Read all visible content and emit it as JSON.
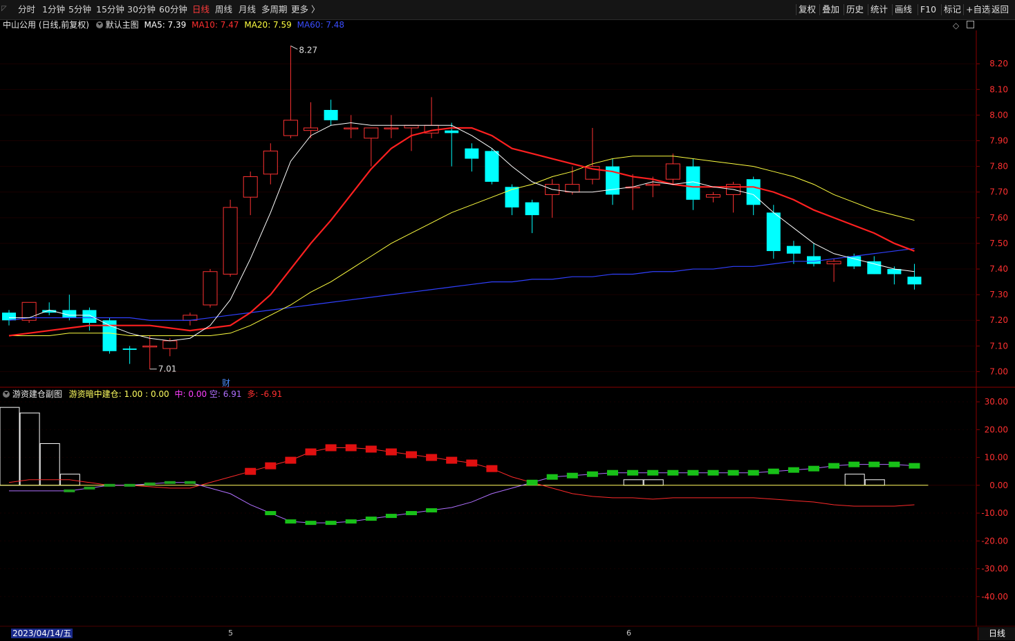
{
  "toolbar": {
    "periods": [
      "分时",
      "1分钟",
      "5分钟",
      "15分钟",
      "30分钟",
      "60分钟",
      "日线",
      "周线",
      "月线",
      "多周期",
      "更多 〉"
    ],
    "active_period": "日线",
    "tools": [
      "复权",
      "叠加",
      "历史",
      "统计",
      "画线",
      "F10",
      "标记",
      "+自选",
      "返回"
    ]
  },
  "main_legend": {
    "title": "中山公用 (日线,前复权)",
    "template": "默认主图",
    "ma5": "MA5: 7.39",
    "ma10": "MA10: 7.47",
    "ma20": "MA20: 7.59",
    "ma60": "MA60: 7.48",
    "colors": {
      "ma5": "#ffffff",
      "ma10": "#ff2020",
      "ma20": "#ffff40",
      "ma60": "#3040ff"
    }
  },
  "sub_legend": {
    "title": "游资建仓副图",
    "item1_label": "游资暗中建仓:",
    "item1_value": "1.00",
    "item1_sep": ":",
    "item1_value2": "0.00",
    "zhong": "中: 0.00",
    "kong": "空: 6.91",
    "duo": "多: -6.91"
  },
  "annotations": {
    "high": "8.27",
    "low": "7.01",
    "fin_marker": "财"
  },
  "price_axis": [
    "8.20",
    "8.10",
    "8.00",
    "7.90",
    "7.80",
    "7.70",
    "7.60",
    "7.50",
    "7.40",
    "7.30",
    "7.20",
    "7.10",
    "7.00"
  ],
  "sub_axis": [
    "30.00",
    "20.00",
    "10.00",
    "0.00",
    "-10.00",
    "-20.00",
    "-30.00",
    "-40.00"
  ],
  "footer": {
    "date": "2023/04/14/五",
    "month_5": "5",
    "month_6": "6",
    "period": "日线"
  },
  "colors": {
    "up": "#ff3232",
    "down": "#00ffff",
    "grid": "#8b0000",
    "bg": "#000000"
  },
  "chart_data": {
    "type": "candlestick",
    "ylim": [
      6.95,
      8.33
    ],
    "candles": [
      {
        "o": 7.23,
        "h": 7.24,
        "l": 7.18,
        "c": 7.2
      },
      {
        "o": 7.2,
        "h": 7.27,
        "l": 7.19,
        "c": 7.27
      },
      {
        "o": 7.24,
        "h": 7.27,
        "l": 7.22,
        "c": 7.23
      },
      {
        "o": 7.24,
        "h": 7.3,
        "l": 7.2,
        "c": 7.21
      },
      {
        "o": 7.24,
        "h": 7.25,
        "l": 7.16,
        "c": 7.19
      },
      {
        "o": 7.2,
        "h": 7.21,
        "l": 7.07,
        "c": 7.08
      },
      {
        "o": 7.09,
        "h": 7.1,
        "l": 7.03,
        "c": 7.085
      },
      {
        "o": 7.1,
        "h": 7.14,
        "l": 7.01,
        "c": 7.1
      },
      {
        "o": 7.09,
        "h": 7.13,
        "l": 7.06,
        "c": 7.12
      },
      {
        "o": 7.2,
        "h": 7.23,
        "l": 7.18,
        "c": 7.22
      },
      {
        "o": 7.26,
        "h": 7.4,
        "l": 7.25,
        "c": 7.39
      },
      {
        "o": 7.38,
        "h": 7.67,
        "l": 7.37,
        "c": 7.64
      },
      {
        "o": 7.68,
        "h": 7.78,
        "l": 7.61,
        "c": 7.76
      },
      {
        "o": 7.77,
        "h": 7.89,
        "l": 7.73,
        "c": 7.86
      },
      {
        "o": 7.92,
        "h": 8.27,
        "l": 7.91,
        "c": 7.98
      },
      {
        "o": 7.94,
        "h": 8.05,
        "l": 7.91,
        "c": 7.95
      },
      {
        "o": 8.02,
        "h": 8.06,
        "l": 7.96,
        "c": 7.98
      },
      {
        "o": 7.95,
        "h": 8.0,
        "l": 7.91,
        "c": 7.95
      },
      {
        "o": 7.91,
        "h": 7.95,
        "l": 7.8,
        "c": 7.95
      },
      {
        "o": 7.95,
        "h": 8.0,
        "l": 7.91,
        "c": 7.95
      },
      {
        "o": 7.95,
        "h": 7.96,
        "l": 7.86,
        "c": 7.96
      },
      {
        "o": 7.93,
        "h": 8.07,
        "l": 7.91,
        "c": 7.96
      },
      {
        "o": 7.94,
        "h": 7.97,
        "l": 7.8,
        "c": 7.93
      },
      {
        "o": 7.87,
        "h": 7.89,
        "l": 7.78,
        "c": 7.83
      },
      {
        "o": 7.86,
        "h": 7.87,
        "l": 7.73,
        "c": 7.74
      },
      {
        "o": 7.72,
        "h": 7.73,
        "l": 7.61,
        "c": 7.64
      },
      {
        "o": 7.66,
        "h": 7.67,
        "l": 7.54,
        "c": 7.61
      },
      {
        "o": 7.69,
        "h": 7.75,
        "l": 7.6,
        "c": 7.73
      },
      {
        "o": 7.7,
        "h": 7.8,
        "l": 7.69,
        "c": 7.73
      },
      {
        "o": 7.75,
        "h": 7.95,
        "l": 7.73,
        "c": 7.8
      },
      {
        "o": 7.8,
        "h": 7.83,
        "l": 7.65,
        "c": 7.69
      },
      {
        "o": 7.72,
        "h": 7.77,
        "l": 7.63,
        "c": 7.72
      },
      {
        "o": 7.73,
        "h": 7.76,
        "l": 7.68,
        "c": 7.73
      },
      {
        "o": 7.75,
        "h": 7.85,
        "l": 7.73,
        "c": 7.81
      },
      {
        "o": 7.8,
        "h": 7.83,
        "l": 7.63,
        "c": 7.67
      },
      {
        "o": 7.68,
        "h": 7.7,
        "l": 7.66,
        "c": 7.69
      },
      {
        "o": 7.69,
        "h": 7.74,
        "l": 7.62,
        "c": 7.73
      },
      {
        "o": 7.75,
        "h": 7.76,
        "l": 7.61,
        "c": 7.65
      },
      {
        "o": 7.62,
        "h": 7.65,
        "l": 7.44,
        "c": 7.47
      },
      {
        "o": 7.49,
        "h": 7.51,
        "l": 7.42,
        "c": 7.46
      },
      {
        "o": 7.45,
        "h": 7.5,
        "l": 7.41,
        "c": 7.42
      },
      {
        "o": 7.42,
        "h": 7.44,
        "l": 7.35,
        "c": 7.43
      },
      {
        "o": 7.45,
        "h": 7.46,
        "l": 7.4,
        "c": 7.41
      },
      {
        "o": 7.43,
        "h": 7.45,
        "l": 7.38,
        "c": 7.38
      },
      {
        "o": 7.4,
        "h": 7.41,
        "l": 7.34,
        "c": 7.38
      },
      {
        "o": 7.37,
        "h": 7.42,
        "l": 7.32,
        "c": 7.34
      }
    ],
    "ma5": [
      7.21,
      7.21,
      7.24,
      7.22,
      7.22,
      7.18,
      7.15,
      7.13,
      7.12,
      7.13,
      7.18,
      7.28,
      7.44,
      7.62,
      7.82,
      7.92,
      7.96,
      7.97,
      7.96,
      7.96,
      7.96,
      7.96,
      7.96,
      7.92,
      7.87,
      7.8,
      7.74,
      7.71,
      7.7,
      7.7,
      7.71,
      7.72,
      7.74,
      7.73,
      7.74,
      7.72,
      7.71,
      7.69,
      7.62,
      7.56,
      7.5,
      7.46,
      7.44,
      7.42,
      7.4,
      7.39
    ],
    "ma10": [
      7.14,
      7.15,
      7.16,
      7.17,
      7.18,
      7.18,
      7.18,
      7.18,
      7.17,
      7.16,
      7.17,
      7.18,
      7.23,
      7.3,
      7.4,
      7.5,
      7.59,
      7.69,
      7.79,
      7.87,
      7.92,
      7.94,
      7.95,
      7.95,
      7.92,
      7.87,
      7.85,
      7.83,
      7.81,
      7.79,
      7.78,
      7.76,
      7.75,
      7.73,
      7.72,
      7.72,
      7.72,
      7.72,
      7.7,
      7.67,
      7.63,
      7.6,
      7.57,
      7.54,
      7.5,
      7.47
    ],
    "ma20": [
      7.14,
      7.14,
      7.14,
      7.15,
      7.15,
      7.15,
      7.14,
      7.14,
      7.14,
      7.14,
      7.14,
      7.15,
      7.18,
      7.22,
      7.26,
      7.31,
      7.35,
      7.4,
      7.45,
      7.5,
      7.54,
      7.58,
      7.62,
      7.65,
      7.68,
      7.71,
      7.73,
      7.76,
      7.78,
      7.81,
      7.83,
      7.84,
      7.84,
      7.84,
      7.83,
      7.82,
      7.81,
      7.8,
      7.78,
      7.76,
      7.73,
      7.69,
      7.66,
      7.63,
      7.61,
      7.59
    ],
    "ma60": [
      7.2,
      7.21,
      7.21,
      7.21,
      7.21,
      7.21,
      7.21,
      7.2,
      7.2,
      7.2,
      7.21,
      7.22,
      7.23,
      7.24,
      7.25,
      7.26,
      7.27,
      7.28,
      7.29,
      7.3,
      7.31,
      7.32,
      7.33,
      7.34,
      7.35,
      7.35,
      7.36,
      7.36,
      7.37,
      7.37,
      7.38,
      7.38,
      7.39,
      7.39,
      7.4,
      7.4,
      7.41,
      7.41,
      7.42,
      7.43,
      7.43,
      7.44,
      7.45,
      7.46,
      7.47,
      7.48
    ],
    "sub_ylim": [
      -50,
      34
    ],
    "kong": [
      1,
      2,
      2,
      2,
      1,
      0,
      0,
      -0.5,
      -1,
      -1,
      1,
      3,
      5,
      7,
      9,
      12,
      13.5,
      13.5,
      13,
      12,
      11,
      10,
      9,
      8,
      6,
      3,
      1,
      -1,
      -3,
      -4,
      -4.5,
      -4.5,
      -5,
      -4.5,
      -4.5,
      -4.5,
      -4.5,
      -4.5,
      -5,
      -5.5,
      -6,
      -7,
      -7.5,
      -7.5,
      -7.5,
      -7
    ],
    "duo": [
      -2,
      -2,
      -2,
      -2,
      -1,
      0,
      0,
      0.5,
      1,
      1,
      -1,
      -3,
      -7,
      -10,
      -13,
      -13.5,
      -13.5,
      -13,
      -12,
      -11,
      -10,
      -9,
      -8,
      -6,
      -3,
      -1,
      1,
      3,
      3.5,
      4,
      4.5,
      4.5,
      4.5,
      4.5,
      4.5,
      4.5,
      4.5,
      4.5,
      5,
      5.5,
      6,
      7,
      7.5,
      7.5,
      7.5,
      7
    ],
    "boxes": [
      {
        "i": 0,
        "v": 28
      },
      {
        "i": 1,
        "v": 26
      },
      {
        "i": 2,
        "v": 15
      },
      {
        "i": 3,
        "v": 4
      },
      {
        "i": 31,
        "v": 2
      },
      {
        "i": 32,
        "v": 2
      },
      {
        "i": 42,
        "v": 4
      },
      {
        "i": 43,
        "v": 2
      }
    ],
    "x_month_labels": [
      "5",
      "6"
    ]
  }
}
